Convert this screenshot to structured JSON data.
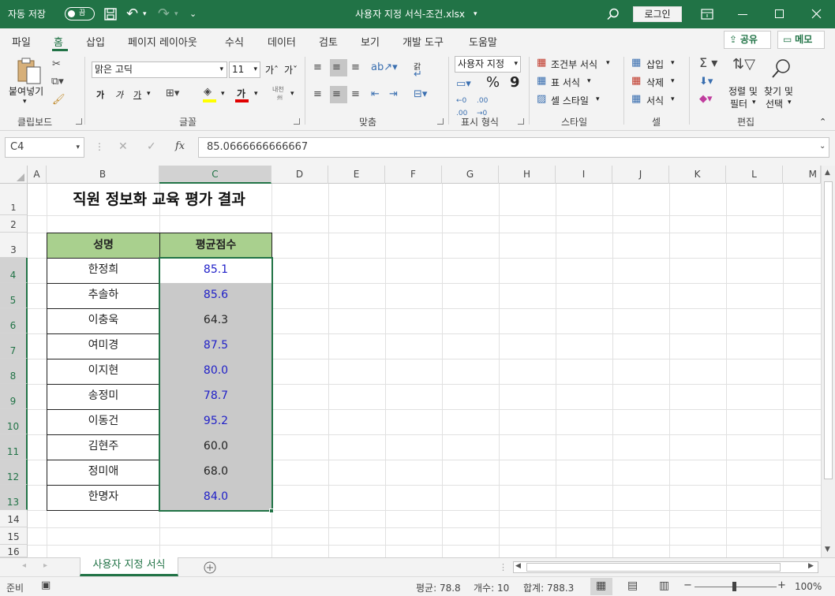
{
  "titlebar": {
    "autosave_label": "자동 저장",
    "autosave_state": "끔",
    "doc_title": "사용자 지정 서식-조건.xlsx",
    "login_label": "로그인"
  },
  "tabs": [
    "파일",
    "홈",
    "삽입",
    "페이지 레이아웃",
    "수식",
    "데이터",
    "검토",
    "보기",
    "개발 도구",
    "도움말"
  ],
  "share_label": "공유",
  "memo_label": "메모",
  "ribbon": {
    "clipboard": {
      "paste_label": "붙여넣기",
      "group": "클립보드"
    },
    "font": {
      "name": "맑은 고딕",
      "size": "11",
      "group": "글꼴",
      "bold": "가",
      "italic": "가",
      "underline": "가",
      "color_letter": "가",
      "grow": "가ˆ",
      "shrink": "가ˇ",
      "phonetic_top": "내천",
      "phonetic_bottom": "州"
    },
    "align": {
      "group": "맞춤",
      "wrap_label": "갉"
    },
    "number": {
      "format": "사용자 지정",
      "group": "표시 형식",
      "percent": "%",
      "comma": "9"
    },
    "styles": {
      "cond": "조건부 서식",
      "table": "표 서식",
      "cell": "셀 스타일",
      "group": "스타일"
    },
    "cells": {
      "insert": "삽입",
      "delete": "삭제",
      "format": "서식",
      "group": "셀"
    },
    "edit": {
      "sort1": "정렬 및",
      "sort2": "필터",
      "find1": "찾기 및",
      "find2": "선택",
      "group": "편집"
    }
  },
  "formula": {
    "cell_ref": "C4",
    "value": "85.0666666666667"
  },
  "columns": [
    "A",
    "B",
    "C",
    "D",
    "E",
    "F",
    "G",
    "H",
    "I",
    "J",
    "K",
    "L",
    "M"
  ],
  "rows": [
    "1",
    "2",
    "3",
    "4",
    "5",
    "6",
    "7",
    "8",
    "9",
    "10",
    "11",
    "12",
    "13",
    "14",
    "15",
    "16"
  ],
  "sheet": {
    "title": "직원 정보화 교육 평가 결과",
    "header_name": "성명",
    "header_score": "평균점수",
    "records": [
      {
        "name": "한정희",
        "score": "85.1"
      },
      {
        "name": "추솔하",
        "score": "85.6"
      },
      {
        "name": "이충욱",
        "score": "64.3"
      },
      {
        "name": "여미경",
        "score": "87.5"
      },
      {
        "name": "이지현",
        "score": "80.0"
      },
      {
        "name": "송정미",
        "score": "78.7"
      },
      {
        "name": "이동건",
        "score": "95.2"
      },
      {
        "name": "김현주",
        "score": "60.0"
      },
      {
        "name": "정미애",
        "score": "68.0"
      },
      {
        "name": "한명자",
        "score": "84.0"
      }
    ]
  },
  "sheet_tab": "사용자 지정 서식",
  "status": {
    "ready": "준비",
    "average": "평균: 78.8",
    "count": "개수: 10",
    "sum": "합계: 788.3",
    "zoom": "100%"
  },
  "colors": {
    "accent": "#217346",
    "header_fill": "#a9d08e",
    "gray_fill": "#c9c9c9",
    "blue_text": "#1f1fc8"
  }
}
